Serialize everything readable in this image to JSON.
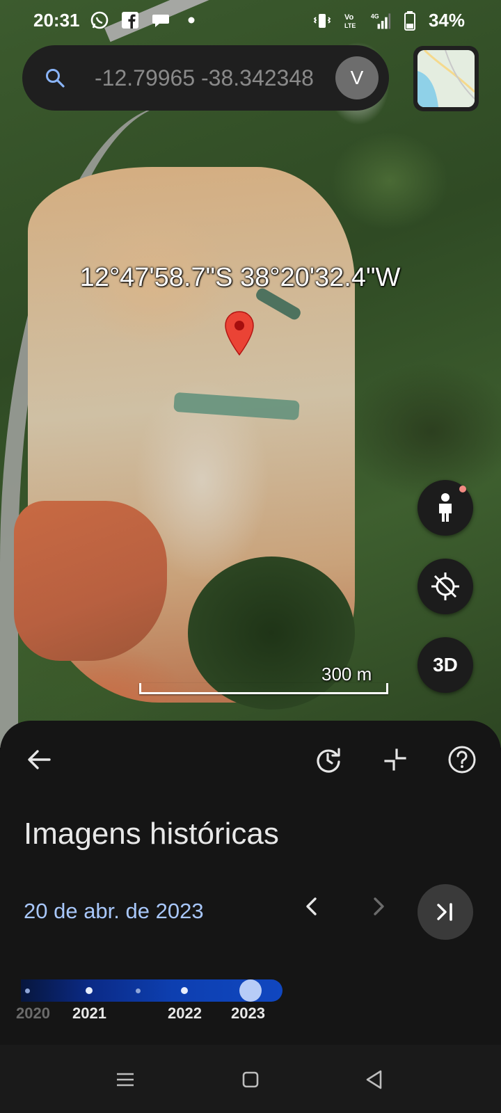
{
  "status_bar": {
    "time": "20:31",
    "battery": "34%",
    "network": "4G"
  },
  "search": {
    "value": "-12.79965 -38.342348",
    "avatar_initial": "V"
  },
  "map": {
    "coordinates_label": "12°47'58.7\"S 38°20'32.4\"W",
    "scale_label": "300 m",
    "button_3d_label": "3D"
  },
  "historical": {
    "title": "Imagens históricas",
    "date": "20 de abr. de 2023",
    "timeline_labels": [
      "2020",
      "2021",
      "2022",
      "2023"
    ],
    "selected_year": "2023"
  },
  "colors": {
    "accent": "#a8c7fa",
    "sheet_bg": "#151515",
    "pin": "#ea4335"
  },
  "icons": [
    "whatsapp-icon",
    "facebook-icon",
    "chat-icon",
    "vibrate-icon",
    "volte-icon",
    "signal-icon",
    "battery-icon",
    "search-icon",
    "layers-icon",
    "pegman-icon",
    "location-off-icon",
    "back-arrow-icon",
    "history-icon",
    "collapse-icon",
    "help-icon",
    "previous-icon",
    "next-icon",
    "skip-to-latest-icon",
    "menu-icon",
    "home-icon",
    "back-icon"
  ]
}
